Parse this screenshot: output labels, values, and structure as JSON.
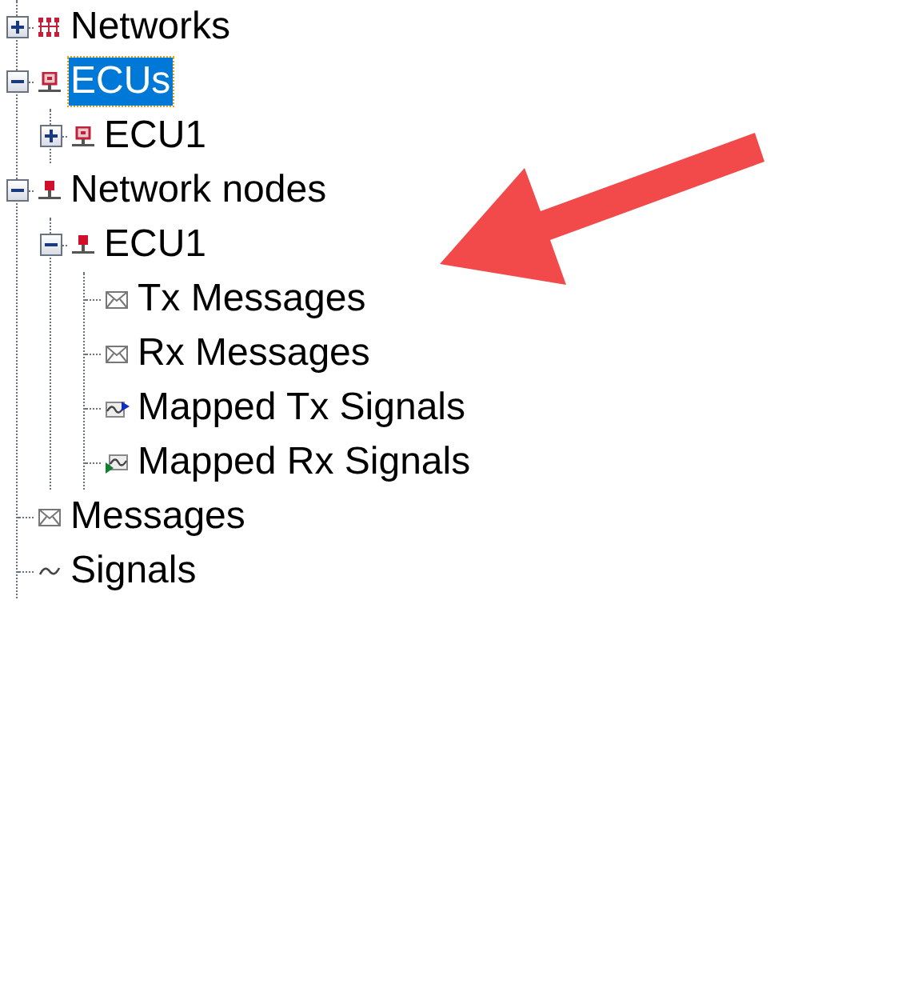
{
  "tree": [
    {
      "label": "Networks",
      "kind": "network",
      "expanded": false,
      "selected": false
    },
    {
      "label": "ECUs",
      "kind": "ecu",
      "expanded": true,
      "selected": true,
      "children": [
        {
          "label": "ECU1",
          "kind": "ecu",
          "expanded": false,
          "selected": false
        }
      ]
    },
    {
      "label": "Network nodes",
      "kind": "node",
      "expanded": true,
      "selected": false,
      "children": [
        {
          "label": "ECU1",
          "kind": "node",
          "expanded": true,
          "selected": false,
          "children": [
            {
              "label": "Tx Messages",
              "kind": "message",
              "selected": false
            },
            {
              "label": "Rx Messages",
              "kind": "message",
              "selected": false
            },
            {
              "label": "Mapped Tx Signals",
              "kind": "tx_signal",
              "selected": false
            },
            {
              "label": "Mapped Rx Signals",
              "kind": "rx_signal",
              "selected": false
            }
          ]
        }
      ]
    },
    {
      "label": "Messages",
      "kind": "message",
      "selected": false
    },
    {
      "label": "Signals",
      "kind": "signal",
      "selected": false
    }
  ]
}
